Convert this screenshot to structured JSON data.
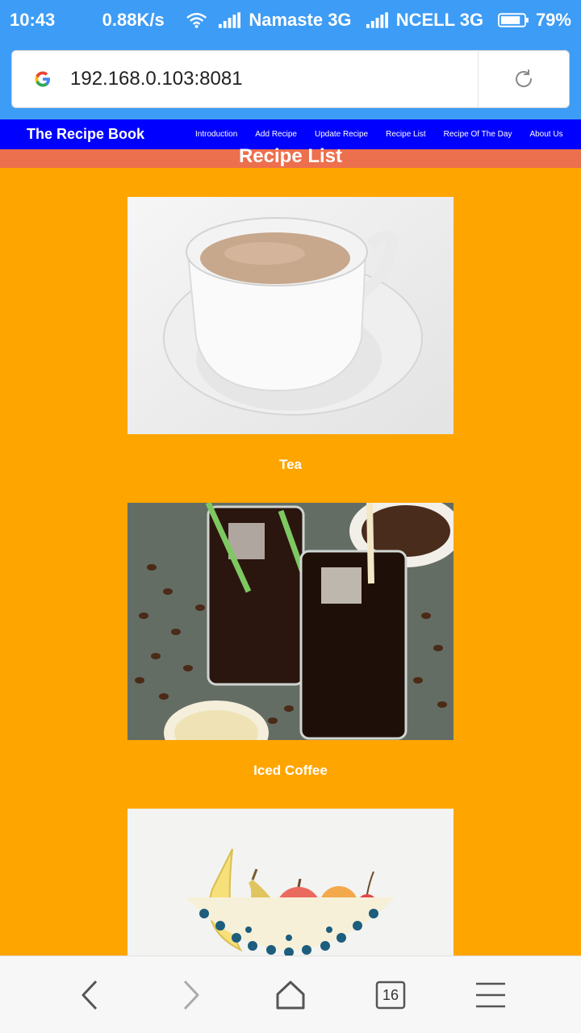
{
  "status_bar": {
    "time": "10:43",
    "speed": "0.88K/s",
    "network1": "Namaste 3G",
    "network2": "NCELL 3G",
    "battery": "79%"
  },
  "browser": {
    "url": "192.168.0.103:8081",
    "tab_count": "16"
  },
  "site_nav": {
    "brand": "The Recipe Book",
    "links": [
      "Introduction",
      "Add Recipe",
      "Update Recipe",
      "Recipe List",
      "Recipe Of The Day",
      "About Us"
    ]
  },
  "page": {
    "title": "Recipe List"
  },
  "recipes": [
    {
      "name": "Tea"
    },
    {
      "name": "Iced Coffee"
    },
    {
      "name": ""
    }
  ],
  "colors": {
    "status_bar": "#3d9cf5",
    "nav": "#0000ff",
    "heading_band": "#ec6f4e",
    "page_bg": "#ffa500"
  }
}
